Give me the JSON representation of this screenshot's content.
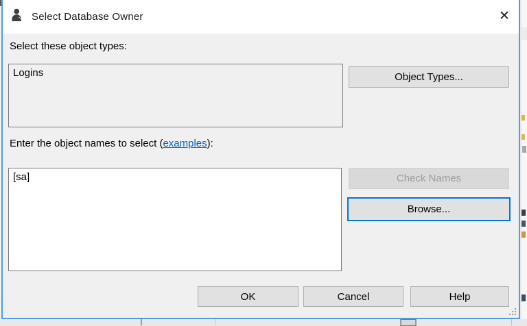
{
  "window": {
    "title": "Select Database Owner",
    "icon": "person-icon",
    "close_glyph": "✕"
  },
  "object_types_section": {
    "label": "Select these object types:",
    "value": "Logins",
    "button_label": "Object Types..."
  },
  "object_names_section": {
    "label_prefix": "Enter the object names to select (",
    "link_label": "examples",
    "label_suffix": "):",
    "value": "[sa]",
    "check_names_label": "Check Names",
    "check_names_enabled": false,
    "browse_label": "Browse..."
  },
  "footer": {
    "ok_label": "OK",
    "cancel_label": "Cancel",
    "help_label": "Help"
  },
  "colors": {
    "accent_border": "#4f9ee3",
    "focus_blue": "#0078d7",
    "link": "#0563c1",
    "dialog_bg": "#f0f0f0",
    "titlebar_bg": "#ffffff",
    "button_bg": "#e1e1e1",
    "button_border": "#adadad",
    "disabled_text": "#9d9d9d"
  }
}
